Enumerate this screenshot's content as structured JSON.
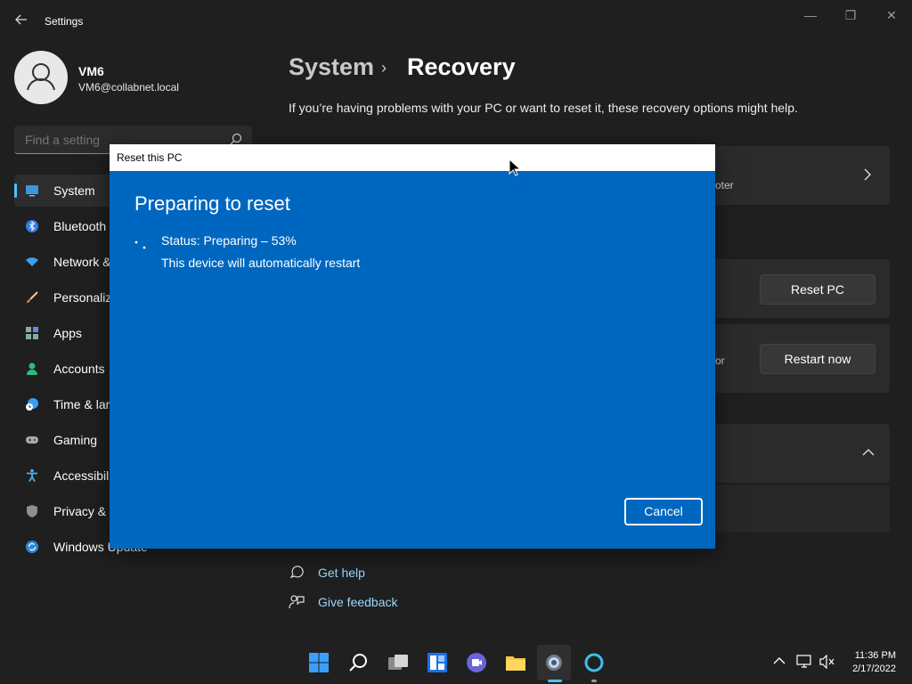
{
  "window": {
    "app_title": "Settings",
    "back_icon": "back-arrow-icon",
    "minimize_glyph": "—",
    "maximize_glyph": "❐",
    "close_glyph": "✕"
  },
  "profile": {
    "name": "VM6",
    "email": "VM6@collabnet.local"
  },
  "search": {
    "placeholder": "Find a setting"
  },
  "nav": {
    "items": [
      {
        "label": "System",
        "icon": "monitor-icon"
      },
      {
        "label": "Bluetooth",
        "icon": "bluetooth-icon"
      },
      {
        "label": "Network &",
        "icon": "wifi-icon"
      },
      {
        "label": "Personaliz",
        "icon": "brush-icon"
      },
      {
        "label": "Apps",
        "icon": "apps-icon"
      },
      {
        "label": "Accounts",
        "icon": "person-icon"
      },
      {
        "label": "Time & lar",
        "icon": "clock-globe-icon"
      },
      {
        "label": "Gaming",
        "icon": "gamepad-icon"
      },
      {
        "label": "Accessibili",
        "icon": "accessibility-icon"
      },
      {
        "label": "Privacy &",
        "icon": "shield-icon"
      },
      {
        "label": "Windows Update",
        "icon": "update-icon"
      }
    ]
  },
  "main": {
    "breadcrumb_parent": "System",
    "breadcrumb_sep": "›",
    "breadcrumb_current": "Recovery",
    "subtitle": "If you’re having problems with your PC or want to reset it, these recovery options might help.",
    "card1_partial": "oter",
    "reset_button": "Reset PC",
    "card3_partial": "or",
    "restart_button": "Restart now",
    "get_help": "Get help",
    "give_feedback": "Give feedback"
  },
  "dialog": {
    "title": "Reset this PC",
    "heading": "Preparing to reset",
    "status": "Status: Preparing – 53%",
    "progress_percent": 53,
    "note": "This device will automatically restart",
    "cancel": "Cancel"
  },
  "taskbar": {
    "icons": [
      "start-icon",
      "search-icon",
      "task-view-icon",
      "widgets-icon",
      "teams-chat-icon",
      "file-explorer-icon",
      "settings-icon",
      "cortana-icon"
    ],
    "time": "11:36 PM",
    "date": "2/17/2022"
  },
  "colors": {
    "accent": "#4cc2ff",
    "dialog_bg": "#0067c0",
    "window_bg": "#1f1f1f"
  }
}
